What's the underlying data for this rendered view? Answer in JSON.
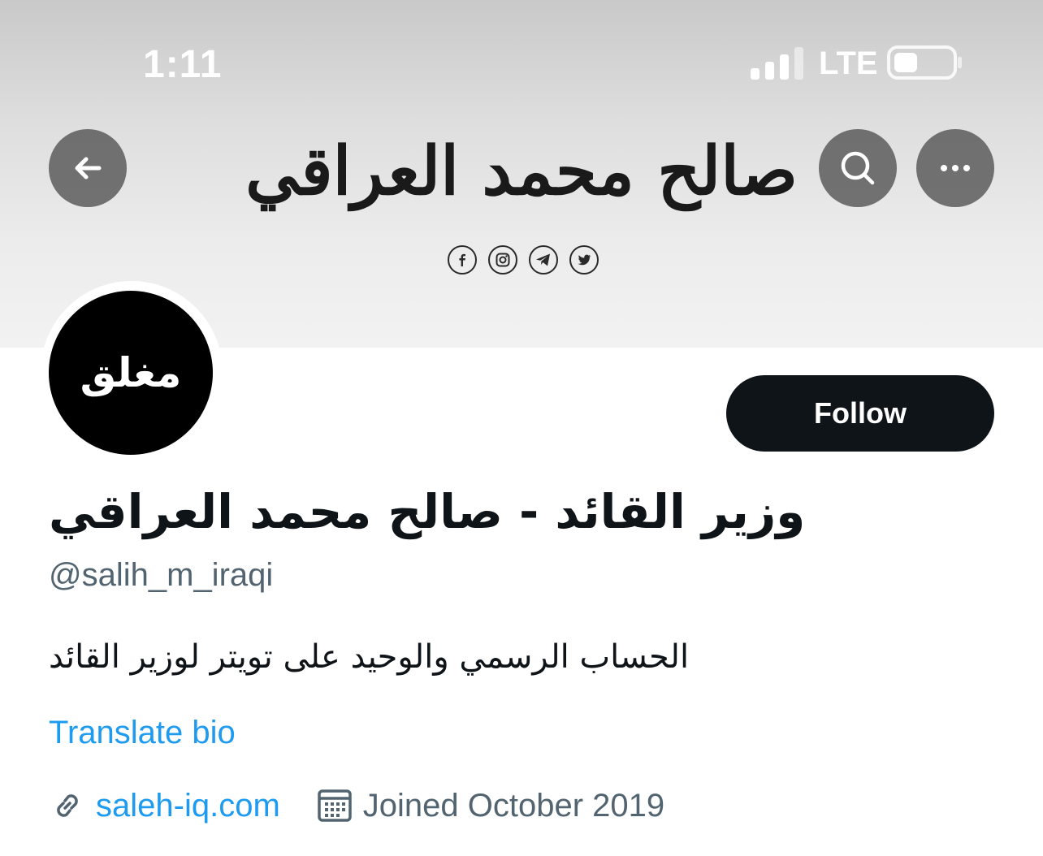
{
  "status_bar": {
    "time": "1:11",
    "network": "LTE"
  },
  "banner": {
    "calligraphy_text": "صالح محمد العراقي",
    "social_icons": [
      "facebook-icon",
      "instagram-icon",
      "telegram-icon",
      "twitter-icon"
    ]
  },
  "nav": {
    "back_icon": "arrow-left-icon",
    "search_icon": "search-icon",
    "more_icon": "more-horizontal-icon"
  },
  "profile": {
    "avatar_text": "مغلق",
    "follow_label": "Follow",
    "display_name": "وزير القائد - صالح محمد العراقي",
    "handle": "@salih_m_iraqi",
    "bio": "الحساب الرسمي والوحيد على تويتر لوزير القائد",
    "translate_label": "Translate bio",
    "website": "saleh-iq.com",
    "joined": "Joined October 2019"
  },
  "colors": {
    "accent": "#1d9bf0",
    "secondary_text": "#536471",
    "primary_text": "#0f1419"
  }
}
